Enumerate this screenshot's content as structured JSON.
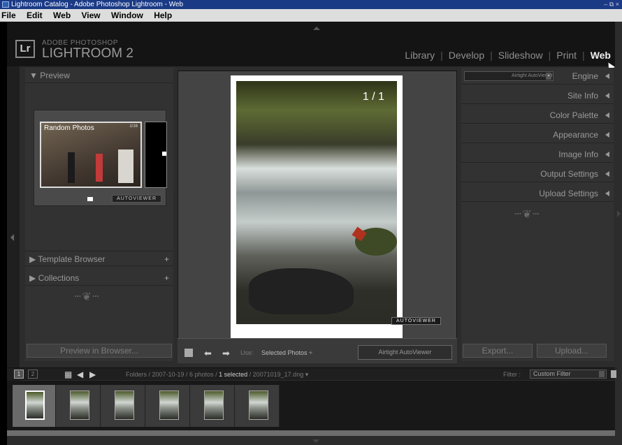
{
  "window": {
    "title": "Lightroom Catalog - Adobe Photoshop Lightroom - Web",
    "controls": "– ⧉ ×"
  },
  "menu": [
    "File",
    "Edit",
    "Web",
    "View",
    "Window",
    "Help"
  ],
  "brand": {
    "logo": "Lr",
    "line1": "ADOBE PHOTOSHOP",
    "line2": "LIGHTROOM 2"
  },
  "modules": [
    "Library",
    "Develop",
    "Slideshow",
    "Print",
    "Web"
  ],
  "active_module": "Web",
  "left_panel": {
    "preview_header": "▼  Preview",
    "preview_caption": "Random Photos",
    "preview_count": "1/16",
    "preview_label": "AUTOVIEWER",
    "template_browser": "▶  Template Browser",
    "collections": "▶  Collections",
    "plus": "+",
    "ornament": "ⵈ❦ⵈ",
    "preview_button": "Preview in Browser..."
  },
  "center": {
    "photo_counter": "1 / 1",
    "photo_caption": "AUTOVIEWER"
  },
  "toolbar": {
    "prev": "⬅",
    "next": "➡",
    "use_label": "Use:",
    "use_value": "Selected Photos ÷",
    "template_name": "Airtight AutoViewer"
  },
  "right_panel": {
    "engine_select": "Airtight AutoViewer",
    "sections": [
      "Engine",
      "Site Info",
      "Color Palette",
      "Appearance",
      "Image Info",
      "Output Settings",
      "Upload Settings"
    ],
    "ornament": "ⵈ❦ⵈ",
    "export_button": "Export...",
    "upload_button": "Upload..."
  },
  "filmstrip_bar": {
    "screen1": "1",
    "screen2": "2",
    "path_prefix": "Folders / 2007-10-19 / 6 photos / ",
    "path_selected": "1 selected",
    "path_suffix": " / 20071019_17.dng ▾",
    "filter_label": "Filter :",
    "filter_value": "Custom Filter"
  },
  "filmstrip": {
    "thumb_count": 6,
    "selected_index": 0
  }
}
